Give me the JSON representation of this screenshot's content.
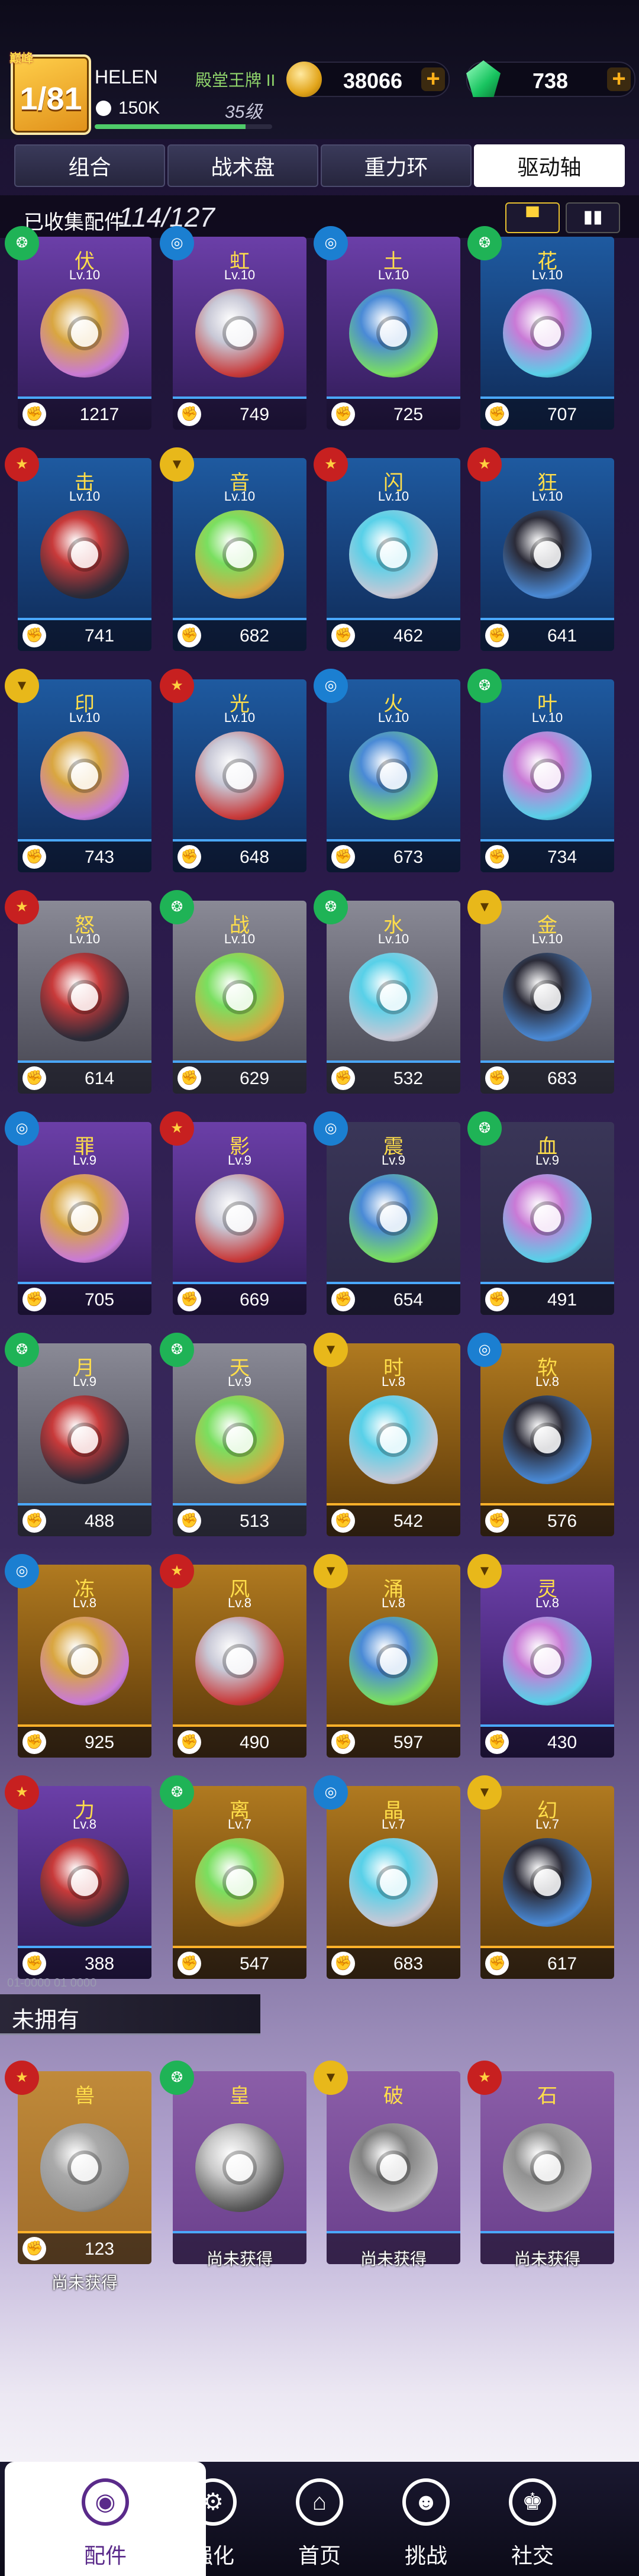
{
  "player": {
    "rank_badge": "巅峰",
    "rank": "1/81",
    "name": "HELEN",
    "title": "殿堂王牌 II",
    "power": "150K",
    "level": "35级",
    "xp_fraction": 0.85
  },
  "currency": {
    "gold": "38066",
    "gems": "738",
    "plus": "+"
  },
  "tabs": [
    "组合",
    "战术盘",
    "重力环",
    "驱动轴"
  ],
  "active_tab": 3,
  "collected": {
    "label": "已收集配件",
    "count": "114/127"
  },
  "unowned_label": "未拥有",
  "unowned_code": "01-0000 01 0000",
  "not_obtained": "尚未获得",
  "owned": [
    {
      "name": "伏",
      "level": "Lv.10",
      "power": "1217",
      "element": "stamina",
      "color": "purple"
    },
    {
      "name": "虹",
      "level": "Lv.10",
      "power": "749",
      "element": "defense",
      "color": "purple"
    },
    {
      "name": "土",
      "level": "Lv.10",
      "power": "725",
      "element": "defense",
      "color": "purple"
    },
    {
      "name": "花",
      "level": "Lv.10",
      "power": "707",
      "element": "stamina",
      "color": "blue"
    },
    {
      "name": "击",
      "level": "Lv.10",
      "power": "741",
      "element": "attack",
      "color": "blue"
    },
    {
      "name": "音",
      "level": "Lv.10",
      "power": "682",
      "element": "balance",
      "color": "blue"
    },
    {
      "name": "闪",
      "level": "Lv.10",
      "power": "462",
      "element": "attack",
      "color": "blue"
    },
    {
      "name": "狂",
      "level": "Lv.10",
      "power": "641",
      "element": "attack",
      "color": "blue"
    },
    {
      "name": "印",
      "level": "Lv.10",
      "power": "743",
      "element": "balance",
      "color": "blue"
    },
    {
      "name": "光",
      "level": "Lv.10",
      "power": "648",
      "element": "attack",
      "color": "blue"
    },
    {
      "name": "火",
      "level": "Lv.10",
      "power": "673",
      "element": "defense",
      "color": "blue"
    },
    {
      "name": "叶",
      "level": "Lv.10",
      "power": "734",
      "element": "stamina",
      "color": "blue"
    },
    {
      "name": "怒",
      "level": "Lv.10",
      "power": "614",
      "element": "attack",
      "color": "gray"
    },
    {
      "name": "战",
      "level": "Lv.10",
      "power": "629",
      "element": "stamina",
      "color": "gray"
    },
    {
      "name": "水",
      "level": "Lv.10",
      "power": "532",
      "element": "stamina",
      "color": "gray"
    },
    {
      "name": "金",
      "level": "Lv.10",
      "power": "683",
      "element": "balance",
      "color": "gray"
    },
    {
      "name": "罪",
      "level": "Lv.9",
      "power": "705",
      "element": "defense",
      "color": "purple"
    },
    {
      "name": "影",
      "level": "Lv.9",
      "power": "669",
      "element": "attack",
      "color": "purple"
    },
    {
      "name": "震",
      "level": "Lv.9",
      "power": "654",
      "element": "defense",
      "color": "dark"
    },
    {
      "name": "血",
      "level": "Lv.9",
      "power": "491",
      "element": "stamina",
      "color": "dark"
    },
    {
      "name": "月",
      "level": "Lv.9",
      "power": "488",
      "element": "stamina",
      "color": "gray"
    },
    {
      "name": "天",
      "level": "Lv.9",
      "power": "513",
      "element": "stamina",
      "color": "gray"
    },
    {
      "name": "时",
      "level": "Lv.8",
      "power": "542",
      "element": "balance",
      "color": "gold"
    },
    {
      "name": "软",
      "level": "Lv.8",
      "power": "576",
      "element": "defense",
      "color": "gold"
    },
    {
      "name": "冻",
      "level": "Lv.8",
      "power": "925",
      "element": "defense",
      "color": "gold"
    },
    {
      "name": "风",
      "level": "Lv.8",
      "power": "490",
      "element": "attack",
      "color": "gold"
    },
    {
      "name": "涌",
      "level": "Lv.8",
      "power": "597",
      "element": "balance",
      "color": "gold"
    },
    {
      "name": "灵",
      "level": "Lv.8",
      "power": "430",
      "element": "balance",
      "color": "purple"
    },
    {
      "name": "力",
      "level": "Lv.8",
      "power": "388",
      "element": "attack",
      "color": "purple"
    },
    {
      "name": "离",
      "level": "Lv.7",
      "power": "547",
      "element": "stamina",
      "color": "gold"
    },
    {
      "name": "晶",
      "level": "Lv.7",
      "power": "683",
      "element": "defense",
      "color": "gold"
    },
    {
      "name": "幻",
      "level": "Lv.7",
      "power": "617",
      "element": "balance",
      "color": "gold"
    }
  ],
  "unowned": [
    {
      "name": "兽",
      "power": "123",
      "element": "attack",
      "color": "gold"
    },
    {
      "name": "皇",
      "power": "",
      "element": "stamina",
      "color": "purple"
    },
    {
      "name": "破",
      "power": "",
      "element": "balance",
      "color": "purple"
    },
    {
      "name": "石",
      "power": "",
      "element": "attack",
      "color": "purple"
    }
  ],
  "nav": [
    {
      "label": "配件",
      "icon": "parts-icon"
    },
    {
      "label": "强化",
      "icon": "upgrade-icon"
    },
    {
      "label": "首页",
      "icon": "home-icon"
    },
    {
      "label": "挑战",
      "icon": "challenge-icon"
    },
    {
      "label": "社交",
      "icon": "social-icon"
    }
  ],
  "colors": {
    "attack": "#c72020",
    "defense": "#1b7fd1",
    "stamina": "#1fb356",
    "balance": "#e8b81a",
    "disc_palette": [
      "#d9a640",
      "#c8c8d6",
      "#4a8ad6",
      "#c97ad6",
      "#c83a3a",
      "#7adf60",
      "#58d0e8",
      "#2b2b38"
    ]
  }
}
